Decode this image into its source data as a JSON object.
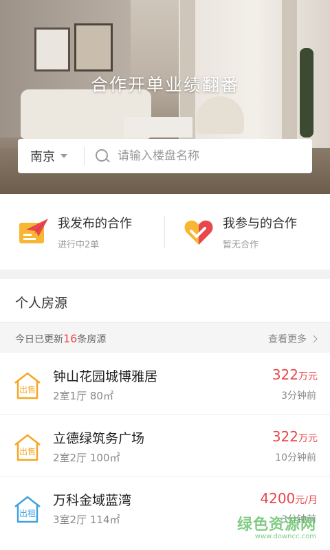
{
  "hero": {
    "title": "合作开单业绩翻番"
  },
  "search": {
    "city": "南京",
    "placeholder": "请输入楼盘名称"
  },
  "cooperation": [
    {
      "title": "我发布的合作",
      "subtitle": "进行中2单",
      "icon": "paper-plane-icon",
      "color": "#f5a623"
    },
    {
      "title": "我参与的合作",
      "subtitle": "暂无合作",
      "icon": "heart-handshake-icon",
      "color": "#f07d3a"
    }
  ],
  "personal": {
    "title": "个人房源",
    "update_prefix": "今日已更新",
    "update_count": "16",
    "update_suffix": "条房源",
    "more": "查看更多"
  },
  "listings": [
    {
      "badge": "出售",
      "badge_color": "#f5a623",
      "name": "钟山花园城博雅居",
      "info": "2室1厅  80㎡",
      "price": "322",
      "unit": "万元",
      "time": "3分钟前"
    },
    {
      "badge": "出售",
      "badge_color": "#f5a623",
      "name": "立德绿筑务广场",
      "info": "2室2厅  100㎡",
      "price": "322",
      "unit": "万元",
      "time": "10分钟前"
    },
    {
      "badge": "出租",
      "badge_color": "#3da2e0",
      "name": "万科金域蓝湾",
      "info": "3室2厅  114㎡",
      "price": "4200",
      "unit": "元/月",
      "time": "3分钟前"
    }
  ],
  "watermark": {
    "main": "绿色资源网",
    "url": "www.downcc.com"
  }
}
